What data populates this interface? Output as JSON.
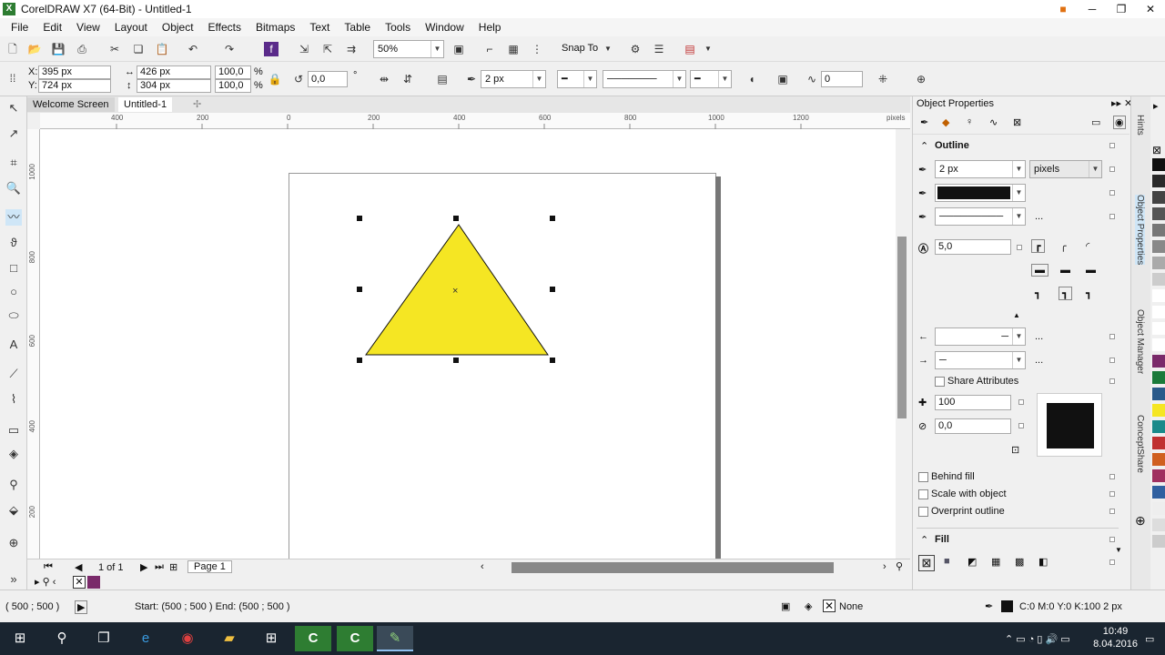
{
  "window": {
    "title": "CorelDRAW X7 (64-Bit) - Untitled-1"
  },
  "menu": [
    "File",
    "Edit",
    "View",
    "Layout",
    "Object",
    "Effects",
    "Bitmaps",
    "Text",
    "Table",
    "Tools",
    "Window",
    "Help"
  ],
  "toolbar": {
    "zoom": "50%",
    "snap_to": "Snap To"
  },
  "propbar": {
    "x_label": "X:",
    "x": "395 px",
    "y_label": "Y:",
    "y": "724 px",
    "w": "426 px",
    "h": "304 px",
    "sx": "100,0",
    "sy": "100,0",
    "pct1": "%",
    "pct2": "%",
    "rotation": "0,0",
    "deg": "°",
    "outline_width": "2 px",
    "corner": "0"
  },
  "tabs": {
    "welcome": "Welcome Screen",
    "doc": "Untitled-1"
  },
  "ruler": {
    "h": [
      "400",
      "200",
      "0",
      "200",
      "400",
      "600",
      "800",
      "1000",
      "1200"
    ],
    "h_unit": "pixels",
    "v": [
      "1000",
      "800",
      "600",
      "400",
      "200"
    ]
  },
  "pages": {
    "count": "1 of 1",
    "page": "Page 1"
  },
  "dock": {
    "title": "Object Properties",
    "outline_section": "Outline",
    "width": "2 px",
    "units": "pixels",
    "miter": "5,0",
    "more1": "...",
    "more2": "...",
    "more3": "...",
    "share_attributes": "Share Attributes",
    "stretch": "100",
    "angle": "0,0",
    "behind_fill": "Behind fill",
    "scale_with_object": "Scale with object",
    "overprint_outline": "Overprint outline",
    "fill_section": "Fill",
    "vtab1": "Hints",
    "vtab2": "Object Properties",
    "vtab3": "Object Manager",
    "vtab4": "ConceptShare"
  },
  "status": {
    "coords": "( 500  ;  500  )",
    "start_end": "Start: (500  ;  500 )  End: (500  ;  500 )",
    "fill": "None",
    "outline": "C:0 M:0 Y:0 K:100  2 px"
  },
  "clock": {
    "time": "10:49",
    "date": "8.04.2016"
  },
  "colors": {
    "triangle_fill": "#f5e623",
    "outline": "#111111",
    "accent": "#2e7d32"
  },
  "palette": [
    "#111",
    "#2a2a2a",
    "#444",
    "#555",
    "#777",
    "#888",
    "#aaa",
    "#ccc",
    "#fff",
    "#fff",
    "#fff",
    "#fff",
    "#7a2a6a",
    "#1a7a3a",
    "#2a5a8a",
    "#f5e623",
    "#1a8a8a",
    "#c03030",
    "#d06020",
    "#a03060",
    "#3060a0",
    "#eee",
    "#ddd",
    "#ccc"
  ]
}
